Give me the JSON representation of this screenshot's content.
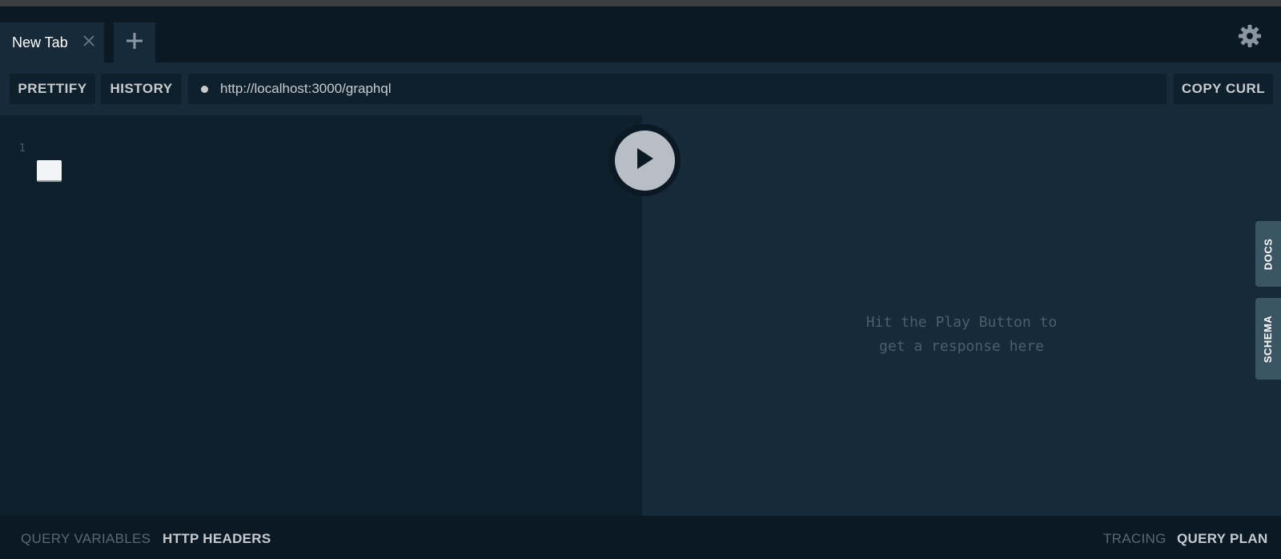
{
  "tabs": [
    {
      "label": "New Tab",
      "active": true
    }
  ],
  "icons": {
    "close": "close-icon",
    "add": "plus-icon",
    "settings": "gear-icon",
    "play": "play-icon"
  },
  "toolbar": {
    "prettify_label": "PRETTIFY",
    "history_label": "HISTORY",
    "endpoint_url": "http://localhost:3000/graphql",
    "copy_curl_label": "COPY CURL"
  },
  "editor": {
    "line_numbers": [
      "1"
    ]
  },
  "result": {
    "placeholder_line1": "Hit the Play Button to",
    "placeholder_line2": "get a response here"
  },
  "side_tabs": {
    "docs_label": "DOCS",
    "schema_label": "SCHEMA"
  },
  "bottom": {
    "query_variables_label": "QUERY VARIABLES",
    "http_headers_label": "HTTP HEADERS",
    "tracing_label": "TRACING",
    "query_plan_label": "QUERY PLAN"
  },
  "colors": {
    "background": "#0b1924",
    "panel": "#172a3a",
    "editor": "#0f202d",
    "side_tab": "#3b5564",
    "text_muted": "#5a6872"
  }
}
